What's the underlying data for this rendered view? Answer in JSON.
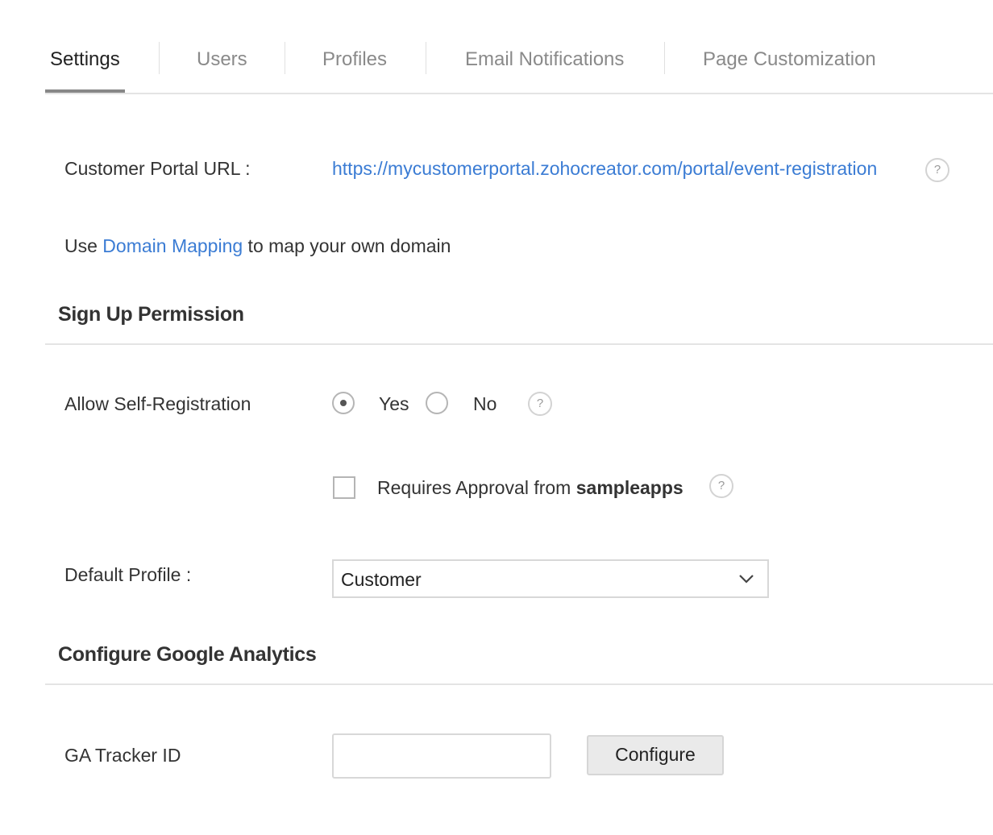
{
  "tabs": [
    {
      "label": "Settings"
    },
    {
      "label": "Users"
    },
    {
      "label": "Profiles"
    },
    {
      "label": "Email Notifications"
    },
    {
      "label": "Page Customization"
    }
  ],
  "portal": {
    "url_label": "Customer Portal URL :",
    "url": "https://mycustomerportal.zohocreator.com/portal/event-registration",
    "help": "?"
  },
  "domain_mapping": {
    "prefix": "Use ",
    "link": "Domain Mapping",
    "suffix": " to map your own domain"
  },
  "signup": {
    "title": "Sign Up Permission",
    "self_registration_label": "Allow Self-Registration",
    "yes_label": "Yes",
    "no_label": "No",
    "selected": "Yes",
    "help": "?",
    "approval_prefix": "Requires Approval from ",
    "approval_bold": "sampleapps",
    "approval_checked": false,
    "approval_help": "?",
    "default_profile_label": "Default Profile :",
    "default_profile_value": "Customer"
  },
  "analytics": {
    "title": "Configure Google Analytics",
    "tracker_label": "GA Tracker ID",
    "tracker_value": "",
    "configure_label": "Configure"
  },
  "colors": {
    "link": "#3b7cd4",
    "active_tab_underline": "#888888",
    "divider": "#e4e4e4"
  }
}
